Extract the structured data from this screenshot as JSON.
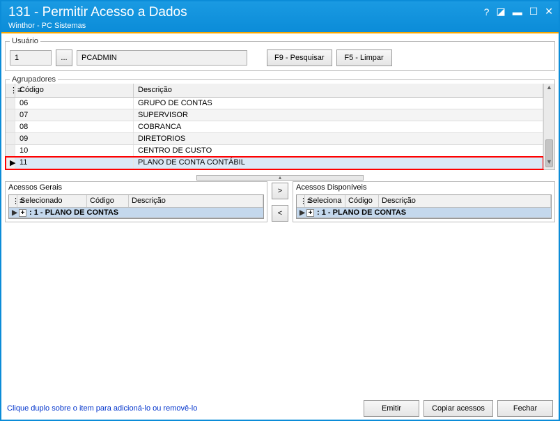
{
  "window": {
    "title": "131 - Permitir Acesso a Dados",
    "subtitle": "Winthor - PC Sistemas"
  },
  "usuario": {
    "legend": "Usuário",
    "codigo": "1",
    "ellipsis": "...",
    "nome": "PCADMIN",
    "btn_pesquisar": "F9 - Pesquisar",
    "btn_limpar": "F5 - Limpar"
  },
  "agrupadores": {
    "legend": "Agrupadores",
    "col_codigo": "Código",
    "col_desc": "Descrição",
    "rows": [
      {
        "codigo": "06",
        "desc": "GRUPO DE CONTAS"
      },
      {
        "codigo": "07",
        "desc": "SUPERVISOR"
      },
      {
        "codigo": "08",
        "desc": "COBRANCA"
      },
      {
        "codigo": "09",
        "desc": "DIRETORIOS"
      },
      {
        "codigo": "10",
        "desc": "CENTRO DE CUSTO"
      },
      {
        "codigo": "11",
        "desc": "PLANO DE CONTA CONTÁBIL"
      }
    ]
  },
  "acessos_gerais": {
    "title": "Acessos Gerais",
    "col_sel": "Selecionado",
    "col_cod": "Código",
    "col_desc": "Descrição",
    "item": ": 1 - PLANO DE CONTAS"
  },
  "acessos_disp": {
    "title": "Acessos Disponíveis",
    "col_sel": "Seleciona",
    "col_cod": "Código",
    "col_desc": "Descrição",
    "item": ": 1 - PLANO DE CONTAS"
  },
  "transfer": {
    "right": ">",
    "left": "<"
  },
  "footer": {
    "hint": "Clique duplo sobre o item para adicioná-lo ou removê-lo",
    "btn_emitir": "Emitir",
    "btn_copiar": "Copiar acessos",
    "btn_fechar": "Fechar"
  }
}
